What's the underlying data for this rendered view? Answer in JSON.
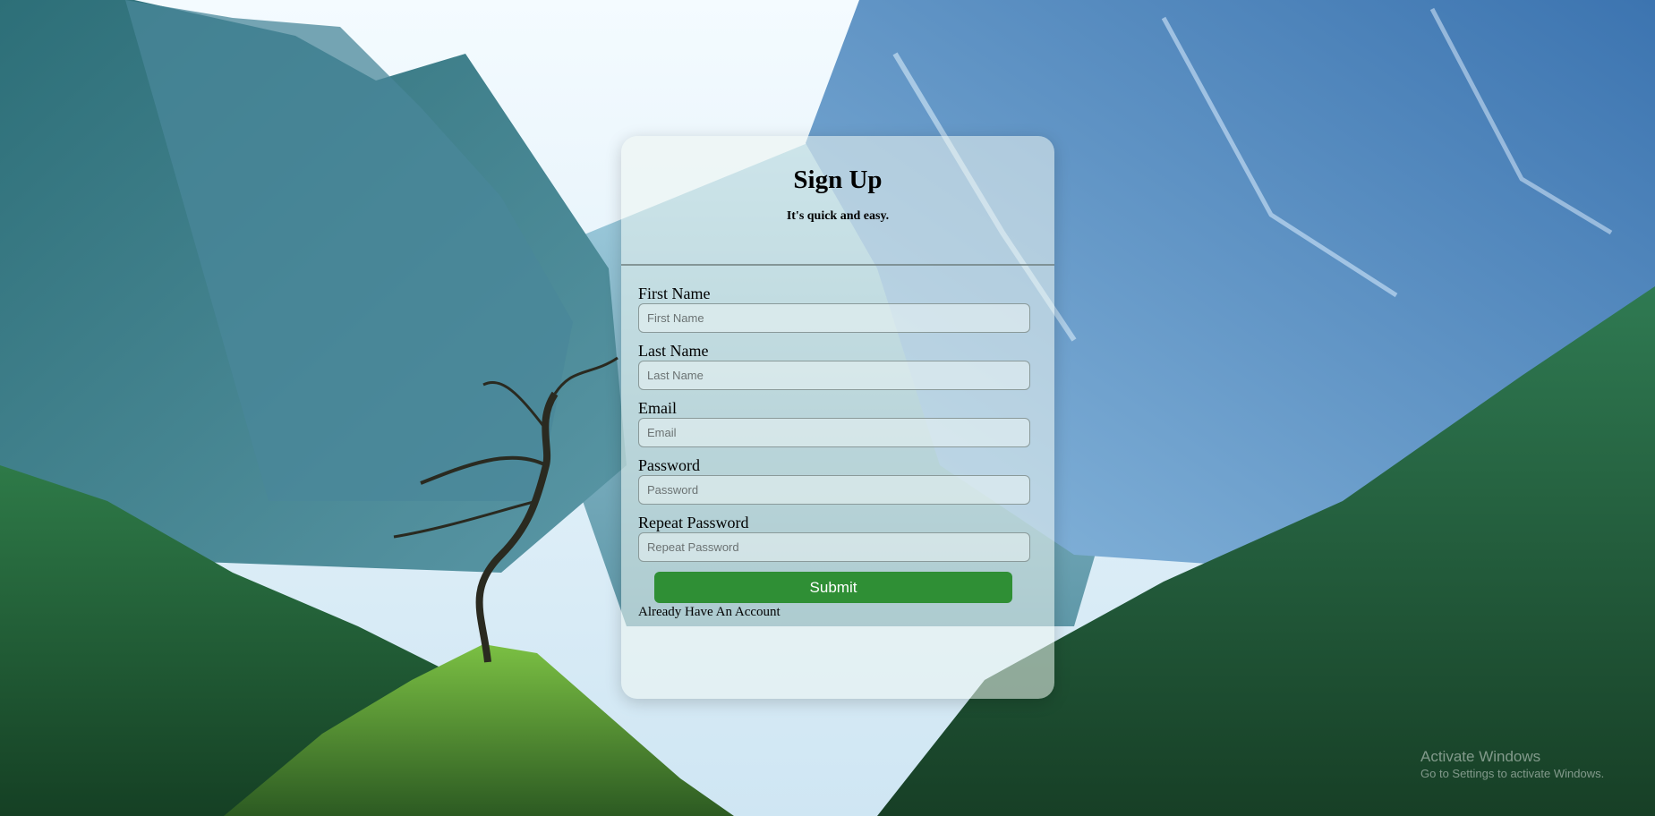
{
  "form": {
    "title": "Sign Up",
    "subtitle": "It's quick and easy.",
    "fields": [
      {
        "label": "First Name",
        "placeholder": "First Name"
      },
      {
        "label": "Last Name",
        "placeholder": "Last Name"
      },
      {
        "label": "Email",
        "placeholder": "Email"
      },
      {
        "label": "Password",
        "placeholder": "Password"
      },
      {
        "label": "Repeat Password",
        "placeholder": "Repeat Password"
      }
    ],
    "submit_label": "Submit",
    "signin_link": "Already Have An Account"
  },
  "watermark": {
    "title": "Activate Windows",
    "subtitle": "Go to Settings to activate Windows."
  },
  "colors": {
    "submit_button": "#2f8f35",
    "sky": "#e8f4fb",
    "mountains": "#4f8aa6",
    "forest": "#2d6b3a"
  }
}
